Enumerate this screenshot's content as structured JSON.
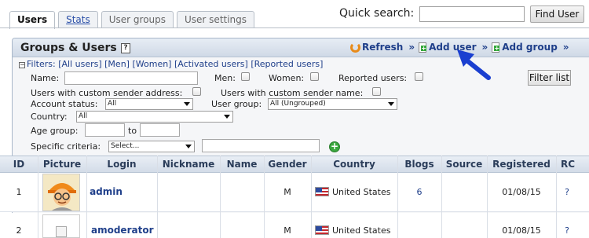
{
  "tabs": [
    "Users",
    "Stats",
    "User groups",
    "User settings"
  ],
  "quick_search": {
    "label": "Quick search:",
    "value": "",
    "button": "Find User"
  },
  "panel": {
    "title": "Groups & Users",
    "help": "?",
    "actions": {
      "refresh": "Refresh",
      "add_user": "Add user",
      "add_group": "Add group",
      "sep": "»"
    }
  },
  "filters": {
    "heading": "Filters:",
    "links": [
      "[All users]",
      "[Men]",
      "[Women]",
      "[Activated users]",
      "[Reported users]"
    ],
    "labels": {
      "name": "Name:",
      "men": "Men:",
      "women": "Women:",
      "reported": "Reported users:",
      "custom_sender_address": "Users with custom sender address:",
      "custom_sender_name": "Users with custom sender name:",
      "account_status": "Account status:",
      "user_group": "User group:",
      "country": "Country:",
      "age_group": "Age group:",
      "age_to": "to",
      "specific_criteria": "Specific criteria:"
    },
    "values": {
      "account_status": "All",
      "user_group": "All (Ungrouped)",
      "country": "All",
      "specific_criteria": "Select..."
    },
    "filter_button": "Filter list"
  },
  "table": {
    "columns": [
      "ID",
      "Picture",
      "Login",
      "Nickname",
      "Name",
      "Gender",
      "Country",
      "Blogs",
      "Source",
      "Registered",
      "RC"
    ],
    "rows": [
      {
        "id": "1",
        "login": "admin",
        "nickname": "",
        "name": "",
        "gender": "M",
        "country": "United States",
        "blogs": "6",
        "source": "",
        "registered": "01/08/15",
        "rc": "?"
      },
      {
        "id": "2",
        "login": "amoderator",
        "nickname": "",
        "name": "",
        "gender": "M",
        "country": "United States",
        "blogs": "",
        "source": "",
        "registered": "01/08/15",
        "rc": "?"
      }
    ]
  }
}
